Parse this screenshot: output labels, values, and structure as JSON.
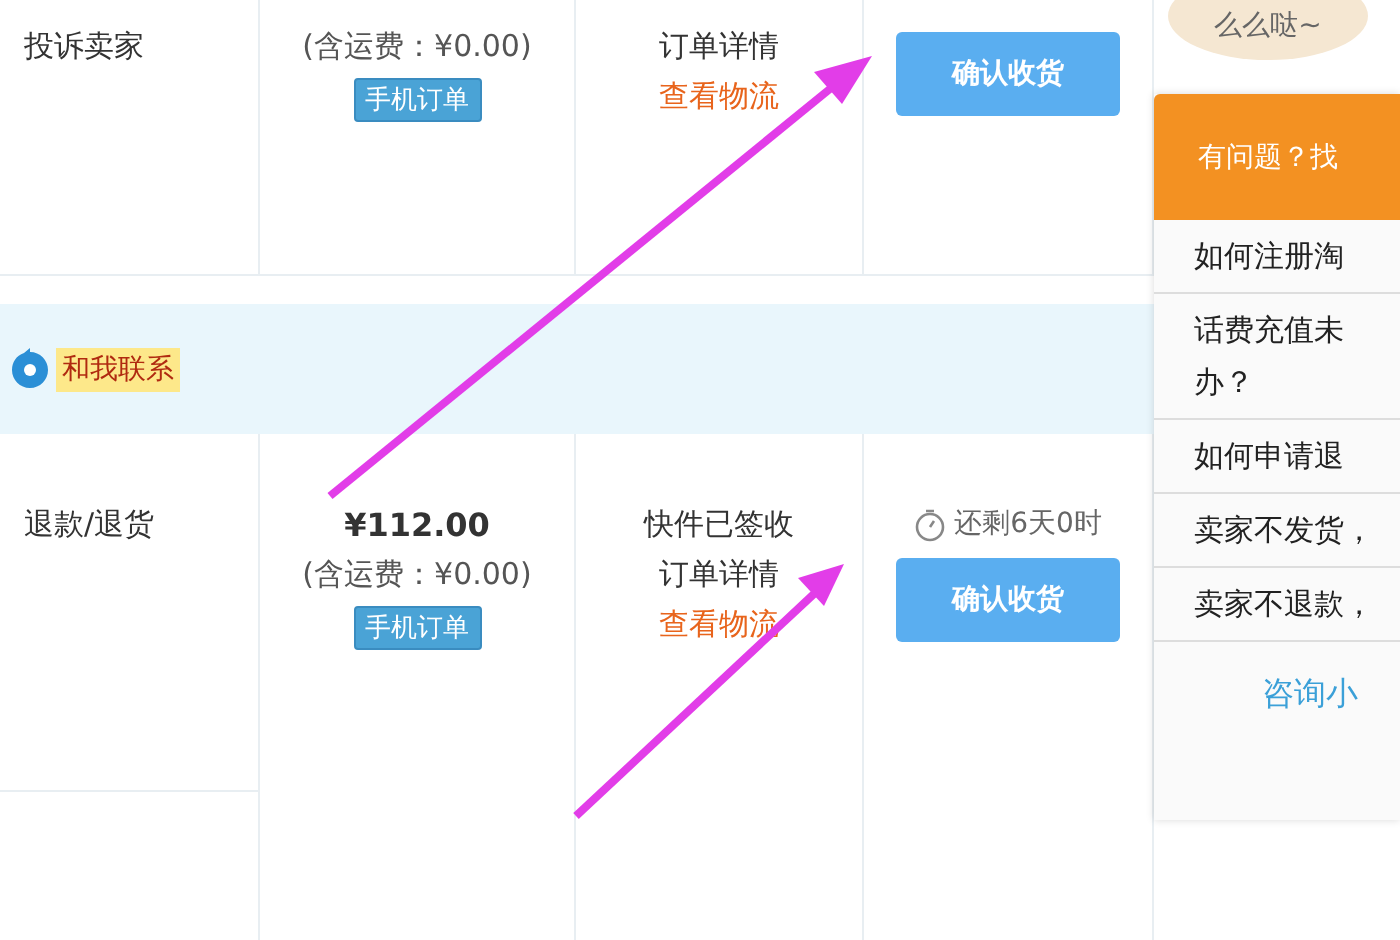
{
  "orders": [
    {
      "refund": "投诉卖家",
      "shipping": "(含运费：¥0.00)",
      "badge": "手机订单",
      "detail_link": "订单详情",
      "logistics_link": "查看物流",
      "confirm_button": "确认收货"
    },
    {
      "refund": "退款/退货",
      "price": "¥112.00",
      "shipping": "(含运费：¥0.00)",
      "badge": "手机订单",
      "status": "快件已签收",
      "detail_link": "订单详情",
      "logistics_link": "查看物流",
      "countdown": "还剩6天0时",
      "confirm_button": "确认收货"
    }
  ],
  "contact": {
    "label": "和我联系"
  },
  "bubble": {
    "text": "么么哒~"
  },
  "help_panel": {
    "header": "有问题？找",
    "questions": [
      {
        "lines": [
          "如何注册淘"
        ]
      },
      {
        "lines": [
          "话费充值未",
          "办？"
        ]
      },
      {
        "lines": [
          "如何申请退"
        ]
      },
      {
        "lines": [
          "卖家不发货，"
        ]
      },
      {
        "lines": [
          "卖家不退款，"
        ]
      }
    ],
    "consult_link": "咨询小"
  }
}
